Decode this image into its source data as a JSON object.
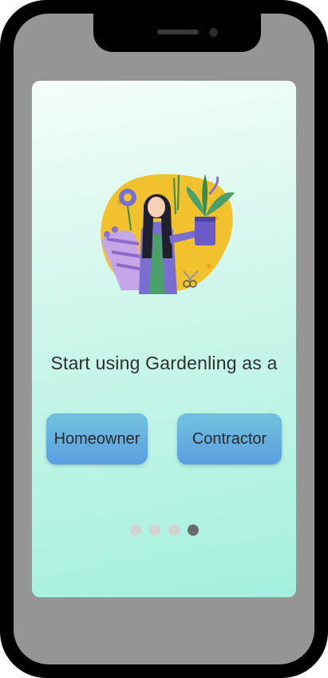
{
  "onboarding": {
    "prompt": "Start using Gardenling as a",
    "buttons": {
      "homeowner": "Homeowner",
      "contractor": "Contractor"
    },
    "pagination": {
      "total_pages": 4,
      "current_page": 4
    }
  },
  "illustration": {
    "icon": "gardener-woman-with-plants-illustration"
  },
  "colors": {
    "screen_gradient_top": "#f4fdf9",
    "screen_gradient_bottom": "#a4f0dd",
    "button_top": "#72c2de",
    "button_bottom": "#5a9ee0",
    "dot_inactive": "#d2d2d2",
    "dot_active": "#6b6b6b",
    "illustration_blob": "#f2c12e"
  }
}
